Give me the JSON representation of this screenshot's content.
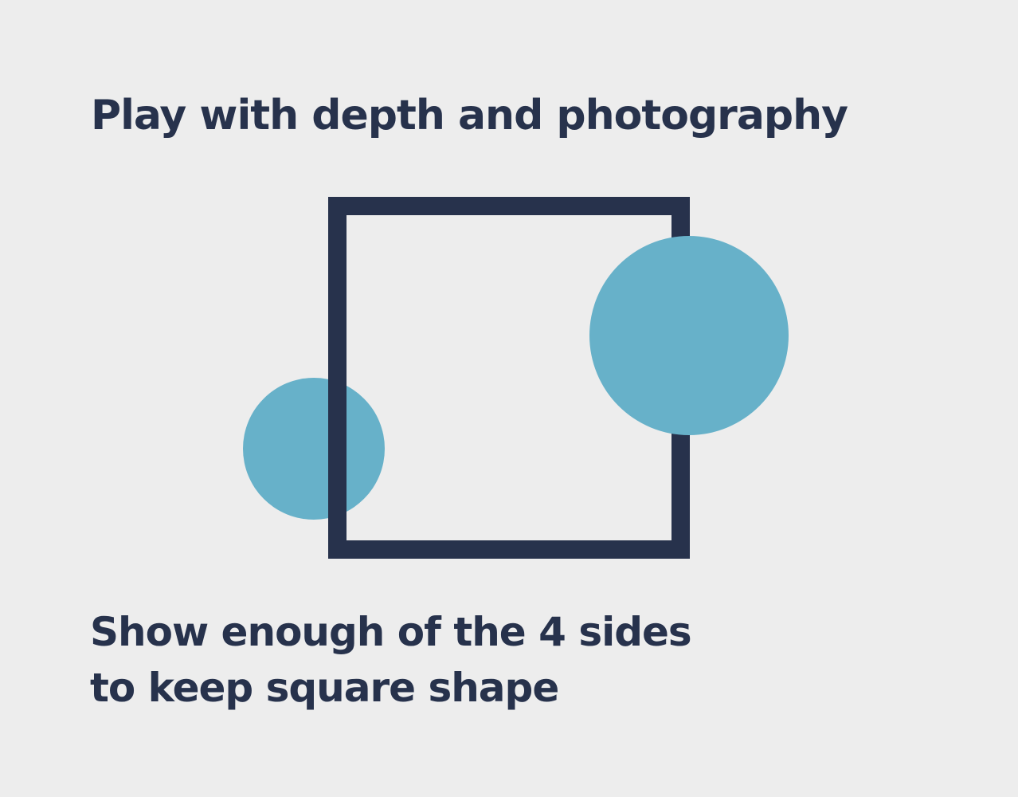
{
  "heading": "Play with depth and photography",
  "caption": {
    "line1": "Show enough of the 4 sides",
    "line2": "to keep square shape"
  },
  "colors": {
    "background": "#ededed",
    "text": "#27324c",
    "frame": "#27324c",
    "circle": "#67b1c9"
  },
  "shapes": {
    "frame": "square-outline",
    "circles": [
      "small-circle",
      "large-circle"
    ]
  }
}
